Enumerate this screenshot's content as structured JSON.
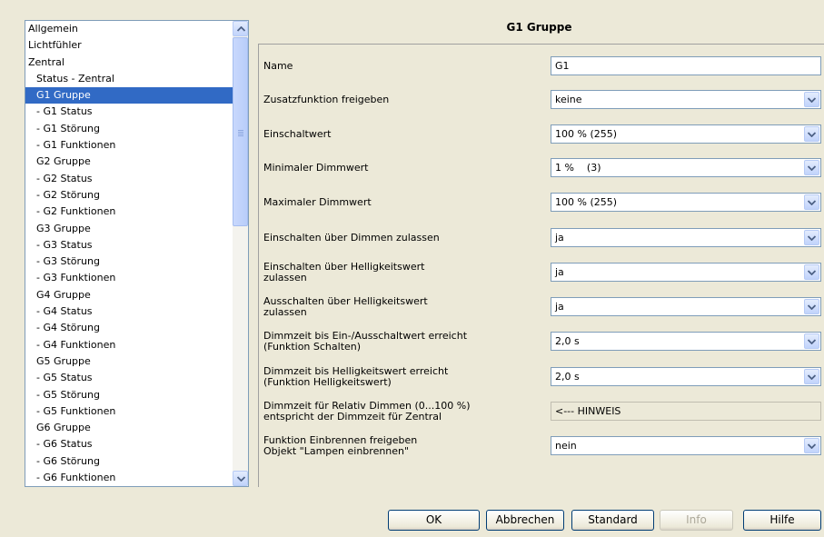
{
  "tree": {
    "items": [
      {
        "label": "Allgemein",
        "level": 0,
        "selected": false
      },
      {
        "label": "Lichtfühler",
        "level": 0,
        "selected": false
      },
      {
        "label": "Zentral",
        "level": 0,
        "selected": false
      },
      {
        "label": "Status - Zentral",
        "level": 1,
        "selected": false
      },
      {
        "label": "G1 Gruppe",
        "level": 1,
        "selected": true
      },
      {
        "label": "- G1 Status",
        "level": 1,
        "selected": false
      },
      {
        "label": "- G1 Störung",
        "level": 1,
        "selected": false
      },
      {
        "label": "- G1 Funktionen",
        "level": 1,
        "selected": false
      },
      {
        "label": "G2 Gruppe",
        "level": 1,
        "selected": false
      },
      {
        "label": "- G2 Status",
        "level": 1,
        "selected": false
      },
      {
        "label": "- G2 Störung",
        "level": 1,
        "selected": false
      },
      {
        "label": "- G2 Funktionen",
        "level": 1,
        "selected": false
      },
      {
        "label": "G3 Gruppe",
        "level": 1,
        "selected": false
      },
      {
        "label": "- G3 Status",
        "level": 1,
        "selected": false
      },
      {
        "label": "- G3 Störung",
        "level": 1,
        "selected": false
      },
      {
        "label": "- G3 Funktionen",
        "level": 1,
        "selected": false
      },
      {
        "label": "G4 Gruppe",
        "level": 1,
        "selected": false
      },
      {
        "label": "- G4 Status",
        "level": 1,
        "selected": false
      },
      {
        "label": "- G4 Störung",
        "level": 1,
        "selected": false
      },
      {
        "label": "- G4 Funktionen",
        "level": 1,
        "selected": false
      },
      {
        "label": "G5 Gruppe",
        "level": 1,
        "selected": false
      },
      {
        "label": "- G5 Status",
        "level": 1,
        "selected": false
      },
      {
        "label": "- G5 Störung",
        "level": 1,
        "selected": false
      },
      {
        "label": "- G5 Funktionen",
        "level": 1,
        "selected": false
      },
      {
        "label": "G6 Gruppe",
        "level": 1,
        "selected": false
      },
      {
        "label": "- G6 Status",
        "level": 1,
        "selected": false
      },
      {
        "label": "- G6 Störung",
        "level": 1,
        "selected": false
      },
      {
        "label": "- G6 Funktionen",
        "level": 1,
        "selected": false
      }
    ]
  },
  "panel": {
    "title": "G1 Gruppe",
    "params": [
      {
        "label": "Name",
        "value": "G1",
        "type": "text"
      },
      {
        "label": "Zusatzfunktion freigeben",
        "value": "keine",
        "type": "select"
      },
      {
        "label": "Einschaltwert",
        "value": "100 % (255)",
        "type": "select"
      },
      {
        "label": "Minimaler Dimmwert",
        "value": "1 %    (3)",
        "type": "select"
      },
      {
        "label": "Maximaler Dimmwert",
        "value": "100 % (255)",
        "type": "select"
      },
      {
        "label": "Einschalten über Dimmen zulassen",
        "value": "ja",
        "type": "select"
      },
      {
        "label": "Einschalten über Helligkeitswert\nzulassen",
        "value": "ja",
        "type": "select"
      },
      {
        "label": "Ausschalten über Helligkeitswert\nzulassen",
        "value": "ja",
        "type": "select"
      },
      {
        "label": "Dimmzeit bis Ein-/Ausschaltwert erreicht\n(Funktion Schalten)",
        "value": "2,0 s",
        "type": "select"
      },
      {
        "label": "Dimmzeit bis Helligkeitswert erreicht\n(Funktion Helligkeitswert)",
        "value": "2,0 s",
        "type": "select"
      },
      {
        "label": "Dimmzeit für Relativ Dimmen (0...100 %)\nentspricht der Dimmzeit für Zentral",
        "value": "<--- HINWEIS",
        "type": "note"
      },
      {
        "label": "Funktion Einbrennen freigeben\nObjekt \"Lampen einbrennen\"",
        "value": "nein",
        "type": "select"
      }
    ]
  },
  "buttons": {
    "ok": "OK",
    "cancel": "Abbrechen",
    "default": "Standard",
    "info": "Info",
    "help": "Hilfe"
  },
  "colors": {
    "selection": "#316ac5",
    "background": "#ece9d8"
  }
}
